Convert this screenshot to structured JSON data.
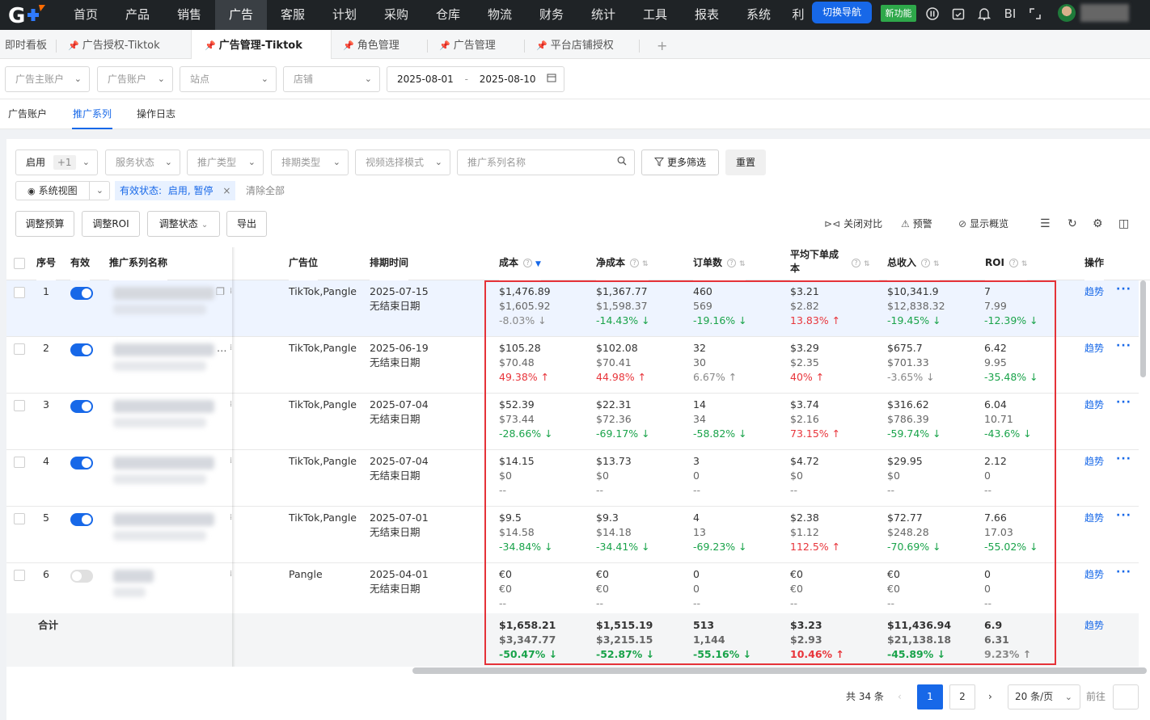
{
  "topnav": {
    "items": [
      "首页",
      "产品",
      "销售",
      "广告",
      "客服",
      "计划",
      "采购",
      "仓库",
      "物流",
      "财务",
      "统计",
      "工具",
      "报表",
      "系统",
      "利"
    ],
    "active_index": 3,
    "switch_nav": "切换导航",
    "new_feature": "新功能",
    "bi": "BI"
  },
  "page_tabs": [
    {
      "label": "即时看板"
    },
    {
      "label": "广告授权-Tiktok"
    },
    {
      "label": "广告管理-Tiktok"
    },
    {
      "label": "角色管理"
    },
    {
      "label": "广告管理"
    },
    {
      "label": "平台店铺授权"
    }
  ],
  "add_tab": "+",
  "filters": {
    "advertiser_account": "广告主账户",
    "ad_account": "广告账户",
    "site": "站点",
    "store": "店铺",
    "date_start": "2025-08-01",
    "date_sep": "-",
    "date_end": "2025-08-10"
  },
  "sub_tabs": [
    "广告账户",
    "推广系列",
    "操作日志"
  ],
  "sub_tab_active": 1,
  "toolbar": {
    "status_select": "启用",
    "status_extra": "+1",
    "service_status": "服务状态",
    "promo_type": "推广类型",
    "schedule_type": "排期类型",
    "video_mode": "视频选择模式",
    "search_placeholder": "推广系列名称",
    "more_filters": "更多筛选",
    "reset": "重置",
    "system_view": "系统视图",
    "active_filter_label": "有效状态:",
    "active_filter_value": "启用, 暂停",
    "clear_all": "清除全部",
    "adjust_budget": "调整预算",
    "adjust_roi": "调整ROI",
    "adjust_status": "调整状态",
    "export": "导出",
    "close_compare": "关闭对比",
    "alert": "预警",
    "show_overview": "显示概览"
  },
  "table": {
    "headers": {
      "index": "序号",
      "valid": "有效",
      "name": "推广系列名称",
      "placement": "广告位",
      "schedule": "排期时间",
      "cost": "成本",
      "net_cost": "净成本",
      "orders": "订单数",
      "avg_cost_1": "平均下单成",
      "avg_cost_2": "本",
      "revenue": "总收入",
      "roi": "ROI",
      "action": "操作"
    },
    "rows": [
      {
        "index": "1",
        "on": true,
        "placement": "TikTok,Pangle",
        "date": "2025-07-15",
        "enddate": "无结束日期",
        "cost": [
          "$1,476.89",
          "$1,605.92",
          "-8.03%",
          "down-flat"
        ],
        "net": [
          "$1,367.77",
          "$1,598.37",
          "-14.43%",
          "down"
        ],
        "orders": [
          "460",
          "569",
          "-19.16%",
          "down"
        ],
        "avg": [
          "$3.21",
          "$2.82",
          "13.83%",
          "up"
        ],
        "rev": [
          "$10,341.9",
          "$12,838.32",
          "-19.45%",
          "down"
        ],
        "roi": [
          "7",
          "7.99",
          "-12.39%",
          "down"
        ]
      },
      {
        "index": "2",
        "on": true,
        "placement": "TikTok,Pangle",
        "date": "2025-06-19",
        "enddate": "无结束日期",
        "cost": [
          "$105.28",
          "$70.48",
          "49.38%",
          "up"
        ],
        "net": [
          "$102.08",
          "$70.41",
          "44.98%",
          "up"
        ],
        "orders": [
          "32",
          "30",
          "6.67%",
          "up-flat"
        ],
        "avg": [
          "$3.29",
          "$2.35",
          "40%",
          "up"
        ],
        "rev": [
          "$675.7",
          "$701.33",
          "-3.65%",
          "down-flat"
        ],
        "roi": [
          "6.42",
          "9.95",
          "-35.48%",
          "down"
        ]
      },
      {
        "index": "3",
        "on": true,
        "placement": "TikTok,Pangle",
        "date": "2025-07-04",
        "enddate": "无结束日期",
        "cost": [
          "$52.39",
          "$73.44",
          "-28.66%",
          "down"
        ],
        "net": [
          "$22.31",
          "$72.36",
          "-69.17%",
          "down"
        ],
        "orders": [
          "14",
          "34",
          "-58.82%",
          "down"
        ],
        "avg": [
          "$3.74",
          "$2.16",
          "73.15%",
          "up"
        ],
        "rev": [
          "$316.62",
          "$786.39",
          "-59.74%",
          "down"
        ],
        "roi": [
          "6.04",
          "10.71",
          "-43.6%",
          "down"
        ]
      },
      {
        "index": "4",
        "on": true,
        "placement": "TikTok,Pangle",
        "date": "2025-07-04",
        "enddate": "无结束日期",
        "cost": [
          "$14.15",
          "$0",
          "--",
          "none"
        ],
        "net": [
          "$13.73",
          "$0",
          "--",
          "none"
        ],
        "orders": [
          "3",
          "0",
          "--",
          "none"
        ],
        "avg": [
          "$4.72",
          "$0",
          "--",
          "none"
        ],
        "rev": [
          "$29.95",
          "$0",
          "--",
          "none"
        ],
        "roi": [
          "2.12",
          "0",
          "--",
          "none"
        ]
      },
      {
        "index": "5",
        "on": true,
        "placement": "TikTok,Pangle",
        "date": "2025-07-01",
        "enddate": "无结束日期",
        "cost": [
          "$9.5",
          "$14.58",
          "-34.84%",
          "down"
        ],
        "net": [
          "$9.3",
          "$14.18",
          "-34.41%",
          "down"
        ],
        "orders": [
          "4",
          "13",
          "-69.23%",
          "down"
        ],
        "avg": [
          "$2.38",
          "$1.12",
          "112.5%",
          "up"
        ],
        "rev": [
          "$72.77",
          "$248.28",
          "-70.69%",
          "down"
        ],
        "roi": [
          "7.66",
          "17.03",
          "-55.02%",
          "down"
        ]
      },
      {
        "index": "6",
        "on": false,
        "placement": "Pangle",
        "date": "2025-04-01",
        "enddate": "无结束日期",
        "cost": [
          "€0",
          "€0",
          "--",
          "none"
        ],
        "net": [
          "€0",
          "€0",
          "--",
          "none"
        ],
        "orders": [
          "0",
          "0",
          "--",
          "none"
        ],
        "avg": [
          "€0",
          "€0",
          "--",
          "none"
        ],
        "rev": [
          "€0",
          "€0",
          "--",
          "none"
        ],
        "roi": [
          "0",
          "0",
          "--",
          "none"
        ]
      }
    ],
    "trend_label": "趋势",
    "more_label": "···",
    "total": {
      "label": "合计",
      "cost": [
        "$1,658.21",
        "$3,347.77",
        "-50.47%",
        "down"
      ],
      "net": [
        "$1,515.19",
        "$3,215.15",
        "-52.87%",
        "down"
      ],
      "orders": [
        "513",
        "1,144",
        "-55.16%",
        "down"
      ],
      "avg": [
        "$3.23",
        "$2.93",
        "10.46%",
        "up"
      ],
      "rev": [
        "$11,436.94",
        "$21,138.18",
        "-45.89%",
        "down"
      ],
      "roi": [
        "6.9",
        "6.31",
        "9.23%",
        "up-flat"
      ]
    }
  },
  "pagination": {
    "total": "共 34 条",
    "pages": [
      "1",
      "2"
    ],
    "current": "1",
    "page_size": "20 条/页",
    "goto": "前往"
  },
  "colors": {
    "brand": "#1768e8",
    "up": "#e8353b",
    "down": "#19a34a",
    "highlight_box": "#e53238"
  }
}
